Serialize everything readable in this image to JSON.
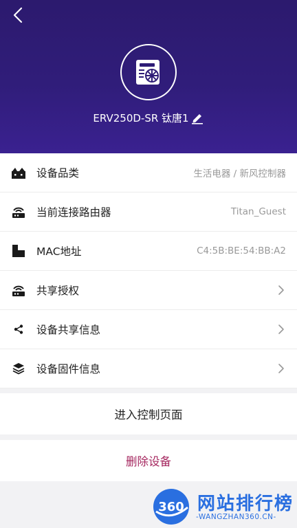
{
  "header": {
    "device_name": "ERV250D-SR 钛唐1",
    "icons": {
      "back": "back-chevron-icon",
      "device": "ventilator-device-icon",
      "edit": "pencil-edit-icon"
    },
    "colors": {
      "gradient_top": "#2c1a6e",
      "gradient_bottom": "#3a2190"
    }
  },
  "info_rows": [
    {
      "label": "设备品类",
      "value": "生活电器 / 新风控制器",
      "icon": "category-icon"
    },
    {
      "label": "当前连接路由器",
      "value": "Titan_Guest",
      "icon": "router-icon"
    },
    {
      "label": "MAC地址",
      "value": "C4:5B:BE:54:BB:A2",
      "icon": "mac-address-icon"
    },
    {
      "label": "共享授权",
      "value": "",
      "icon": "share-authorization-icon"
    },
    {
      "label": "设备共享信息",
      "value": "",
      "icon": "share-icon"
    },
    {
      "label": "设备固件信息",
      "value": "",
      "icon": "firmware-layers-icon"
    }
  ],
  "actions": {
    "enter_control": "进入控制页面",
    "delete_device": "删除设备",
    "delete_color": "#a5275f"
  },
  "watermark": {
    "number": "360",
    "title": "网站排行榜",
    "subtitle": "-WANGZHAN360.CN-",
    "color": "#2a6fe0"
  }
}
